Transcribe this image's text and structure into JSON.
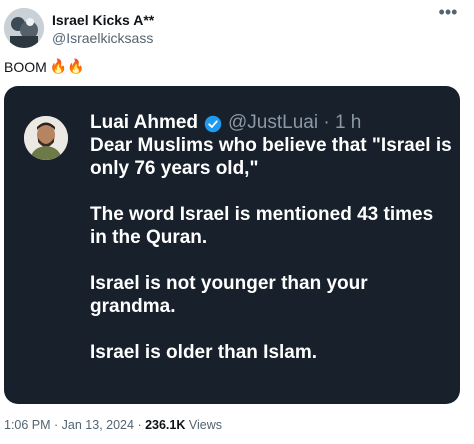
{
  "author": {
    "name": "Israel Kicks A**",
    "handle": "@Israelkicksass"
  },
  "post": {
    "text": "BOOM",
    "emoji": "🔥🔥"
  },
  "quoted": {
    "name": "Luai Ahmed",
    "handle": "@JustLuai · 1 h",
    "paragraphs": [
      "Dear Muslims who believe that \"Israel is only 76 years old,\"",
      "The word Israel is mentioned 43 times in the Quran.",
      "Israel is not younger than your grandma.",
      "Israel is older than Islam."
    ]
  },
  "meta": {
    "time": "1:06 PM",
    "sep1": " · ",
    "date": "Jan 13, 2024",
    "sep2": " · ",
    "views_count": "236.1K",
    "views_label": " Views"
  },
  "colors": {
    "card_bg": "#17202b",
    "verified": "#1d9bf0"
  },
  "icons": {
    "menu": "more-icon",
    "badge": "verified-icon"
  }
}
